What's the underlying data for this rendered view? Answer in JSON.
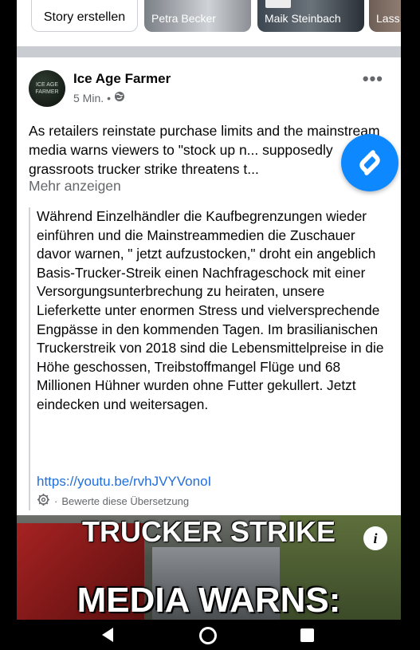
{
  "stories": {
    "create_label": "Story erstellen",
    "cards": [
      {
        "name": "Petra Becker"
      },
      {
        "name": "Maik Steinbach"
      },
      {
        "name": "Lass"
      }
    ]
  },
  "post": {
    "author": "Ice Age Farmer",
    "avatar_text": "ICE AGE FARMER",
    "time": "5 Min.",
    "separator": "•",
    "privacy_icon": "globe-icon",
    "more_icon": "•••",
    "text": "As retailers reinstate purchase limits and the mainstream media warns viewers to \"stock up n... supposedly grassroots trucker strike threatens t...",
    "see_more": "Mehr anzeigen",
    "translation": "Während Einzelhändler die Kaufbegrenzungen wieder einführen und die Mainstreammedien die Zuschauer davor warnen, \" jetzt aufzustocken,\" droht ein angeblich Basis-Trucker-Streik einen Nachfrageschock mit einer Versorgungsunterbrechung zu heiraten, unsere Lieferkette unter enormen Stress und vielversprechende Engpässe in den kommenden Tagen. Im brasilianischen Truckerstreik von 2018 sind die Lebensmittelpreise in die Höhe geschossen, Treibstoffmangel Flüge und 68 Millionen Hühner wurden ohne Futter gekullert. Jetzt eindecken und weitersagen.",
    "link": "https://youtu.be/rvhJVYVonoI",
    "rate_translation": "Bewerte diese Übersetzung",
    "rate_separator": "·"
  },
  "media": {
    "headline_top": "TRUCKER STRIKE",
    "headline_bottom": "MEDIA WARNS:",
    "info_label": "i"
  },
  "colors": {
    "link": "#216fdb",
    "shazam": "#0e88ff",
    "secondary_text": "#65676b"
  }
}
